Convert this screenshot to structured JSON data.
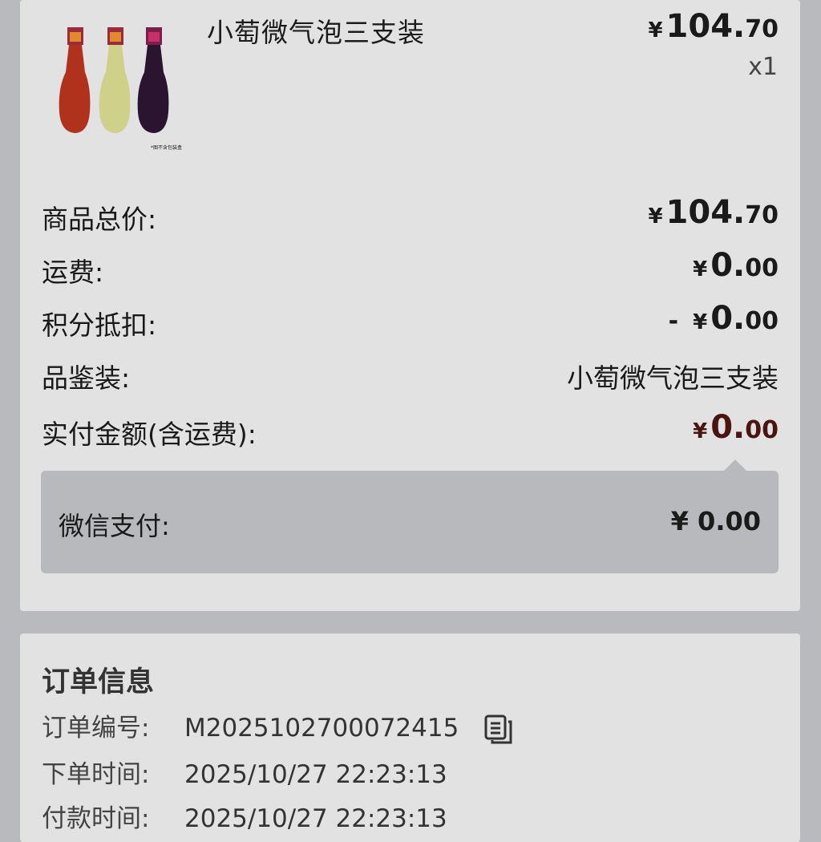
{
  "product": {
    "name": "小萄微气泡三支装",
    "price_yen": "¥",
    "price_int": "104.",
    "price_dec": "70",
    "quantity": "x1",
    "image_caption": "*图不含包装盒"
  },
  "summary": {
    "rows": [
      {
        "label": "商品总价:",
        "yen": "¥",
        "int": "104.",
        "dec": "70"
      },
      {
        "label": "运费:",
        "yen": "¥",
        "int": "0.",
        "dec": "00"
      },
      {
        "label": "积分抵扣:",
        "prefix": "-",
        "yen": "¥",
        "int": "0.",
        "dec": "00"
      },
      {
        "label": "品鉴装:",
        "text": "小萄微气泡三支装"
      },
      {
        "label": "实付金额(含运费):",
        "yen": "¥",
        "int": "0.",
        "dec": "00"
      }
    ]
  },
  "payment": {
    "label": "微信支付:",
    "value": "¥ 0.00"
  },
  "order_info": {
    "title": "订单信息",
    "rows": [
      {
        "key": "订单编号:",
        "value": "M2025102700072415"
      },
      {
        "key": "下单时间:",
        "value": "2025/10/27 22:23:13"
      },
      {
        "key": "付款时间:",
        "value": "2025/10/27 22:23:13"
      }
    ]
  },
  "colors": {
    "background": "#b9babe",
    "card": "#e2e2e3",
    "pay_box": "#b8b9bd",
    "total_amount": "#4a140f"
  },
  "icons": {
    "copy": "copy-icon"
  }
}
